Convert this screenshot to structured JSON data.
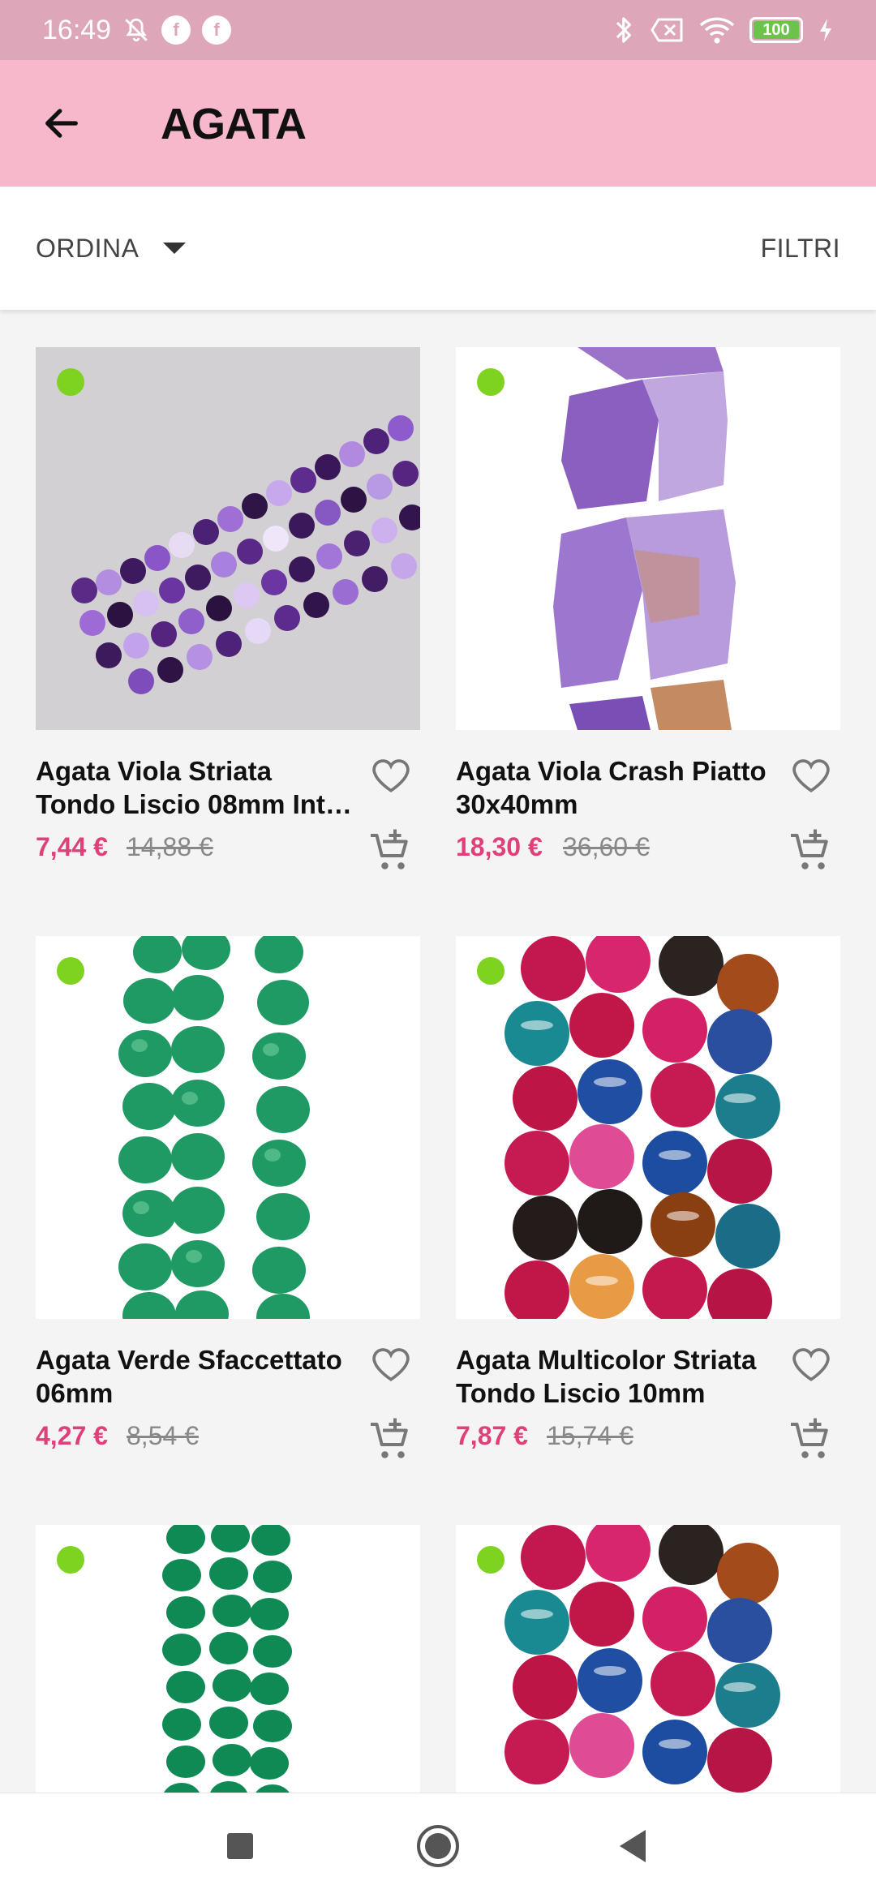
{
  "status_bar": {
    "time": "16:49",
    "badge_1": "f",
    "badge_2": "f",
    "battery": "100",
    "icons": [
      "mute-icon",
      "bluetooth-icon",
      "sim-off-icon",
      "wifi-icon",
      "battery-icon",
      "charging-icon"
    ]
  },
  "app_bar": {
    "title": "AGATA",
    "back_icon": "arrow-left-icon"
  },
  "toolbar": {
    "sort_label": "ORDINA",
    "filter_label": "FILTRI"
  },
  "products": [
    {
      "name": "Agata Viola Striata Tondo Liscio 08mm Int…",
      "price": "7,44 €",
      "old_price": "14,88 €"
    },
    {
      "name": "Agata Viola Crash Piatto 30x40mm",
      "price": "18,30 €",
      "old_price": "36,60 €"
    },
    {
      "name": "Agata Verde Sfaccettato 06mm",
      "price": "4,27 €",
      "old_price": "8,54 €"
    },
    {
      "name": "Agata Multicolor Striata Tondo Liscio 10mm",
      "price": "7,87 €",
      "old_price": "15,74 €"
    },
    {
      "name": "",
      "price": "",
      "old_price": ""
    },
    {
      "name": "",
      "price": "",
      "old_price": ""
    }
  ],
  "colors": {
    "status_bar": "#dda7b9",
    "app_bar": "#f7b8cc",
    "price": "#e0407a",
    "in_stock_dot": "#7ed321"
  },
  "nav_bar": {
    "icons": [
      "recent-apps-icon",
      "home-icon",
      "back-icon"
    ]
  }
}
